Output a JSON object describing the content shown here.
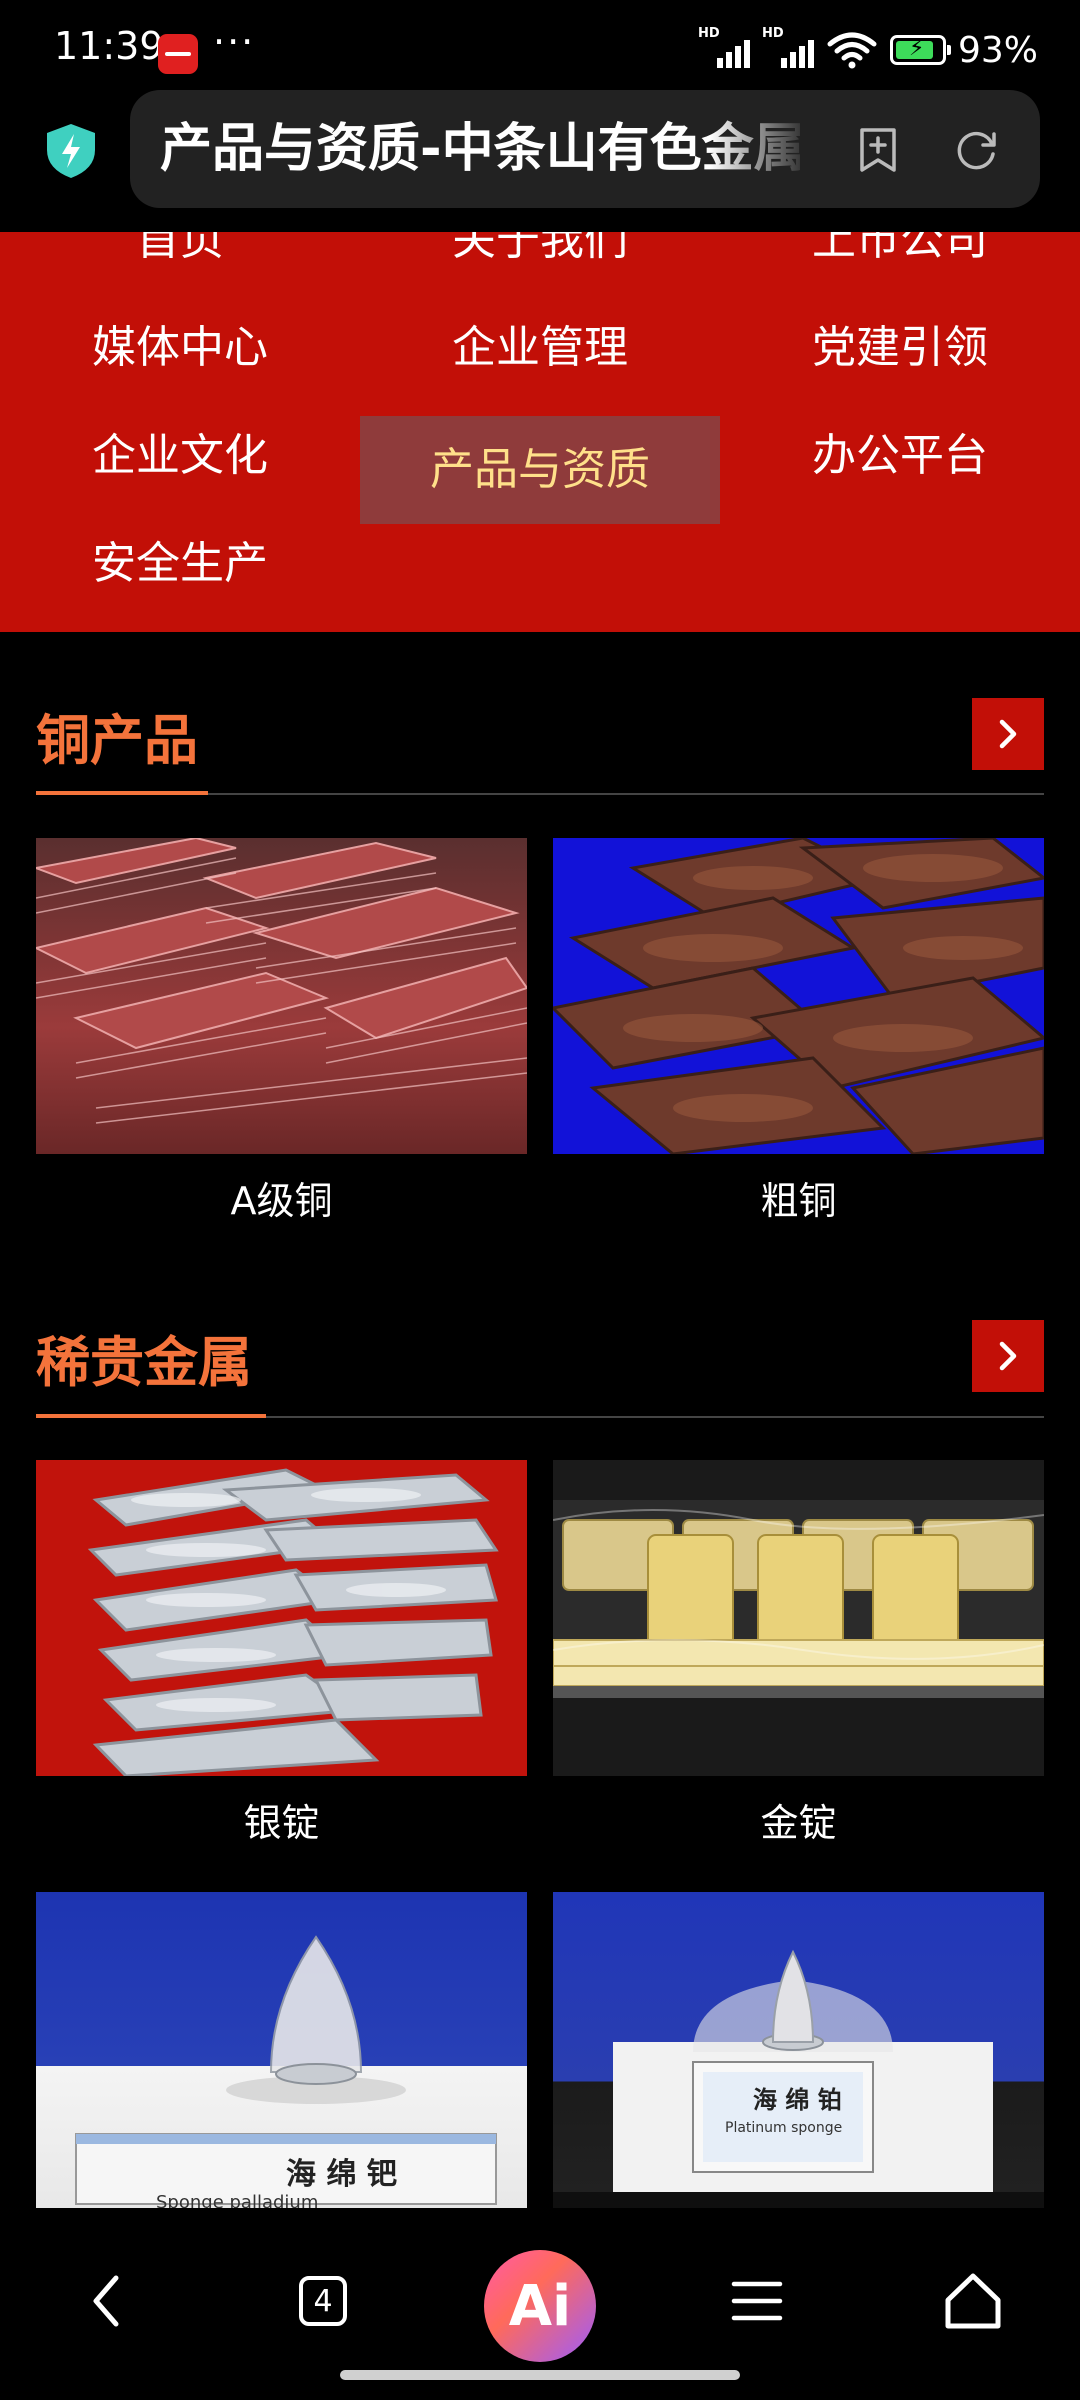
{
  "status_bar": {
    "time": "11:39",
    "dots": "···",
    "signal1_label": "HD",
    "signal2_label": "HD",
    "battery_percent": "93%",
    "battery_level": 0.93
  },
  "browser": {
    "page_title": "产品与资质-中条山有色金属集团",
    "icons": [
      "shield-icon",
      "bookmark-add-icon",
      "refresh-icon"
    ]
  },
  "nav": {
    "items": [
      {
        "label": "首页"
      },
      {
        "label": "关于我们"
      },
      {
        "label": "上市公司"
      },
      {
        "label": "媒体中心"
      },
      {
        "label": "企业管理"
      },
      {
        "label": "党建引领"
      },
      {
        "label": "企业文化"
      },
      {
        "label": "产品与资质",
        "active": true
      },
      {
        "label": "办公平台"
      },
      {
        "label": "安全生产"
      }
    ],
    "active_color": "#ffe08a",
    "bg_color": "#c20f07"
  },
  "sections": [
    {
      "title": "铜产品",
      "products": [
        {
          "label": "A级铜"
        },
        {
          "label": "粗铜"
        }
      ]
    },
    {
      "title": "稀贵金属",
      "products": [
        {
          "label": "银锭"
        },
        {
          "label": "金锭"
        },
        {
          "label": "海绵钯",
          "image_text_en": "Sponge  palladium"
        },
        {
          "label": "海绵铂",
          "image_text_en": "Platinum sponge"
        }
      ]
    }
  ],
  "bottom_nav": {
    "tabs_count": "4",
    "ai_label": "Ai"
  },
  "colors": {
    "accent": "#f4733b",
    "brand_red": "#c20f07"
  }
}
